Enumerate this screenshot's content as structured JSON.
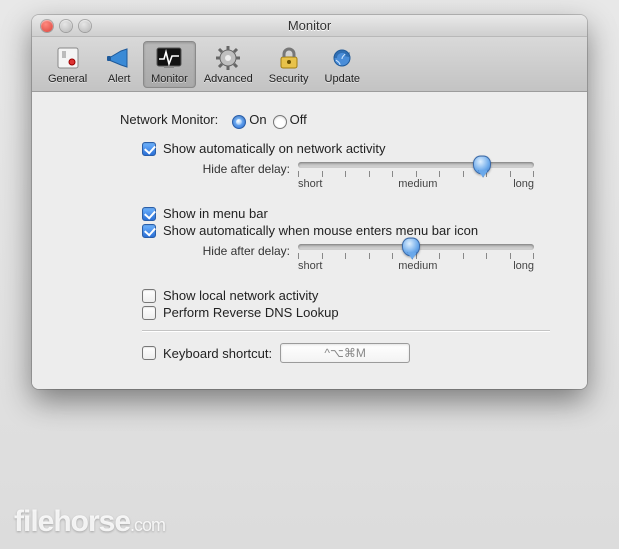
{
  "window": {
    "title": "Monitor"
  },
  "toolbar": {
    "items": [
      {
        "label": "General"
      },
      {
        "label": "Alert"
      },
      {
        "label": "Monitor"
      },
      {
        "label": "Advanced"
      },
      {
        "label": "Security"
      },
      {
        "label": "Update"
      }
    ],
    "selected_index": 2
  },
  "network_monitor": {
    "label": "Network Monitor:",
    "on_label": "On",
    "off_label": "Off",
    "value": "On"
  },
  "options": {
    "show_on_activity": {
      "label": "Show automatically on network activity",
      "checked": true
    },
    "show_in_menubar": {
      "label": "Show in menu bar",
      "checked": true
    },
    "show_on_hover": {
      "label": "Show automatically when mouse enters menu bar icon",
      "checked": true
    },
    "show_local": {
      "label": "Show local network activity",
      "checked": false
    },
    "reverse_dns": {
      "label": "Perform Reverse DNS Lookup",
      "checked": false
    },
    "keyboard_shortcut": {
      "label": "Keyboard shortcut:",
      "checked": false,
      "value": "^⌥⌘M"
    }
  },
  "slider": {
    "label": "Hide after delay:",
    "ticks": {
      "short": "short",
      "medium": "medium",
      "long": "long"
    },
    "activity_value_pct": 78,
    "hover_value_pct": 48
  },
  "watermark": {
    "name": "filehorse",
    "domain": ".com"
  }
}
